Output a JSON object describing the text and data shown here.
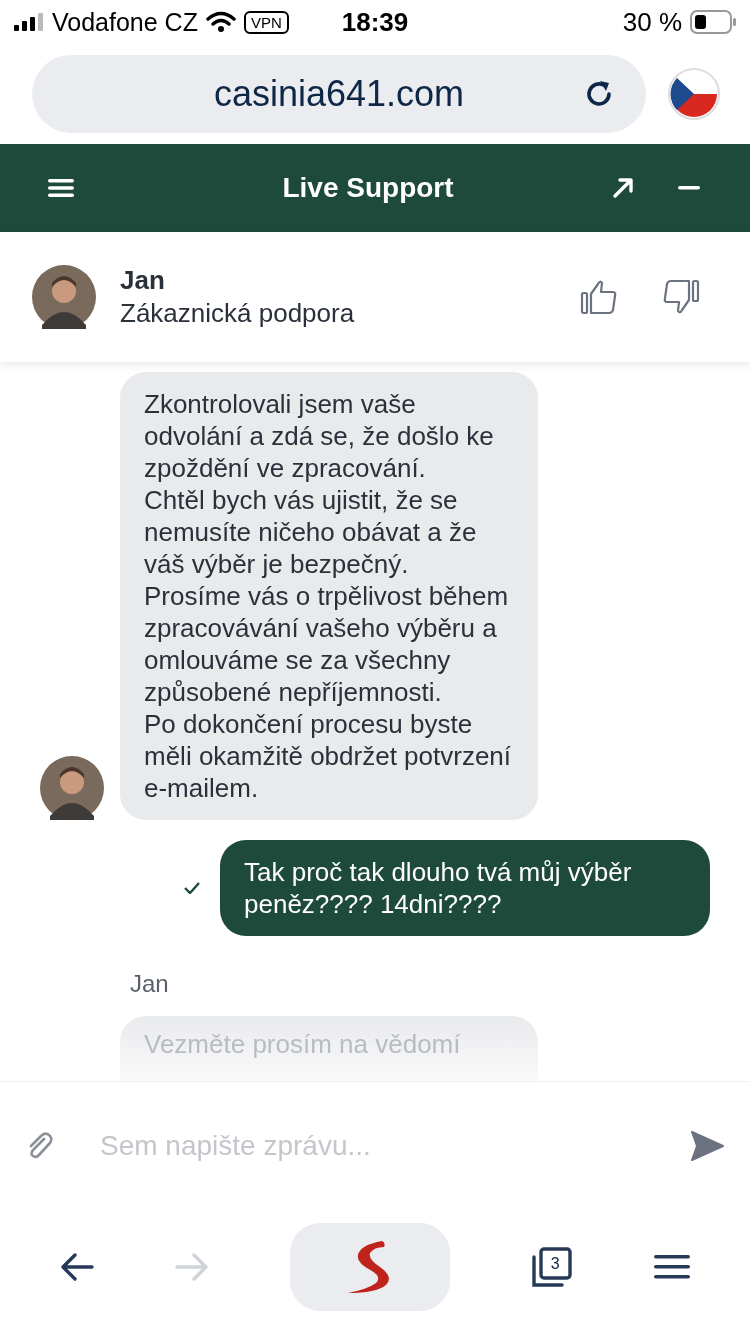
{
  "status_bar": {
    "carrier": "Vodafone CZ",
    "vpn": "VPN",
    "time": "18:39",
    "battery": "30 %"
  },
  "browser": {
    "url": "casinia641.com",
    "tab_count": "3",
    "nav_buttons": [
      {
        "kind": "back",
        "disabled": false
      },
      {
        "kind": "forward",
        "disabled": true
      }
    ]
  },
  "chat_header": {
    "title": "Live Support"
  },
  "agent": {
    "name": "Jan",
    "role": "Zákaznická podpora"
  },
  "messages": [
    {
      "kind": "agent",
      "text": "Zkontrolovali jsem vaše odvolání a zdá se, že došlo ke zpoždění ve zpracování.\nChtěl bych vás ujistit, že se nemusíte ničeho obávat a že váš výběr je bezpečný.\nProsíme vás o trpělivost během zpracovávání vašeho výběru a omlouváme se za všechny způsobené nepříjemnosti.\nPo dokončení procesu byste měli okamžitě obdržet potvrzení e-mailem."
    },
    {
      "kind": "user",
      "text": "Tak proč tak dlouho tvá můj výběr peněz???? 14dni????",
      "delivered": true
    },
    {
      "kind": "sender",
      "text": "Jan"
    },
    {
      "kind": "agent_faded",
      "text": "Vezměte prosím na vědomí"
    }
  ],
  "composer": {
    "placeholder": "Sem napište zprávu..."
  }
}
